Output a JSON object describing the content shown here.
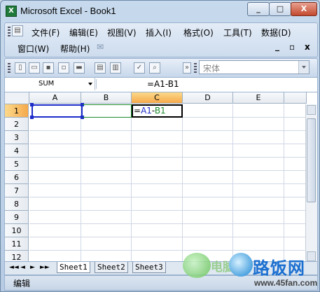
{
  "window": {
    "title": "Microsoft Excel - Book1",
    "min_label": "_",
    "max_label": "□",
    "close_label": "X"
  },
  "menubar": {
    "items": [
      "文件(F)",
      "编辑(E)",
      "视图(V)",
      "插入(I)",
      "格式(O)",
      "工具(T)",
      "数据(D)"
    ],
    "items_row2": [
      "窗口(W)",
      "帮助(H)"
    ],
    "doc_min": "_",
    "doc_restore": "▫",
    "doc_close": "x"
  },
  "toolbar": {
    "font_name": "宋体"
  },
  "formula_bar": {
    "name_box": "SUM",
    "formula": "=A1-B1"
  },
  "sheet": {
    "columns": [
      "A",
      "B",
      "C",
      "D",
      "E"
    ],
    "selected_column": "C",
    "rows": [
      "1",
      "2",
      "3",
      "4",
      "5",
      "6",
      "7",
      "8",
      "9",
      "10",
      "11",
      "12"
    ],
    "selected_row": "1",
    "active_cell_parts": [
      "=",
      "A1",
      "-",
      "B1"
    ]
  },
  "tabs": {
    "nav": [
      "◄◄",
      "◄",
      "►",
      "►►"
    ],
    "sheets": [
      "Sheet1",
      "Sheet2",
      "Sheet3"
    ]
  },
  "status": {
    "text": "编辑"
  },
  "watermark": {
    "text_cn": "电脑",
    "brand": "路饭网",
    "url": "www.45fan.com"
  },
  "colors": {
    "titlebar": "#c7d9ec",
    "selected_header": "#f6a94b",
    "ref_a1": "#1d2cc9",
    "ref_b1": "#1a8a2a"
  }
}
